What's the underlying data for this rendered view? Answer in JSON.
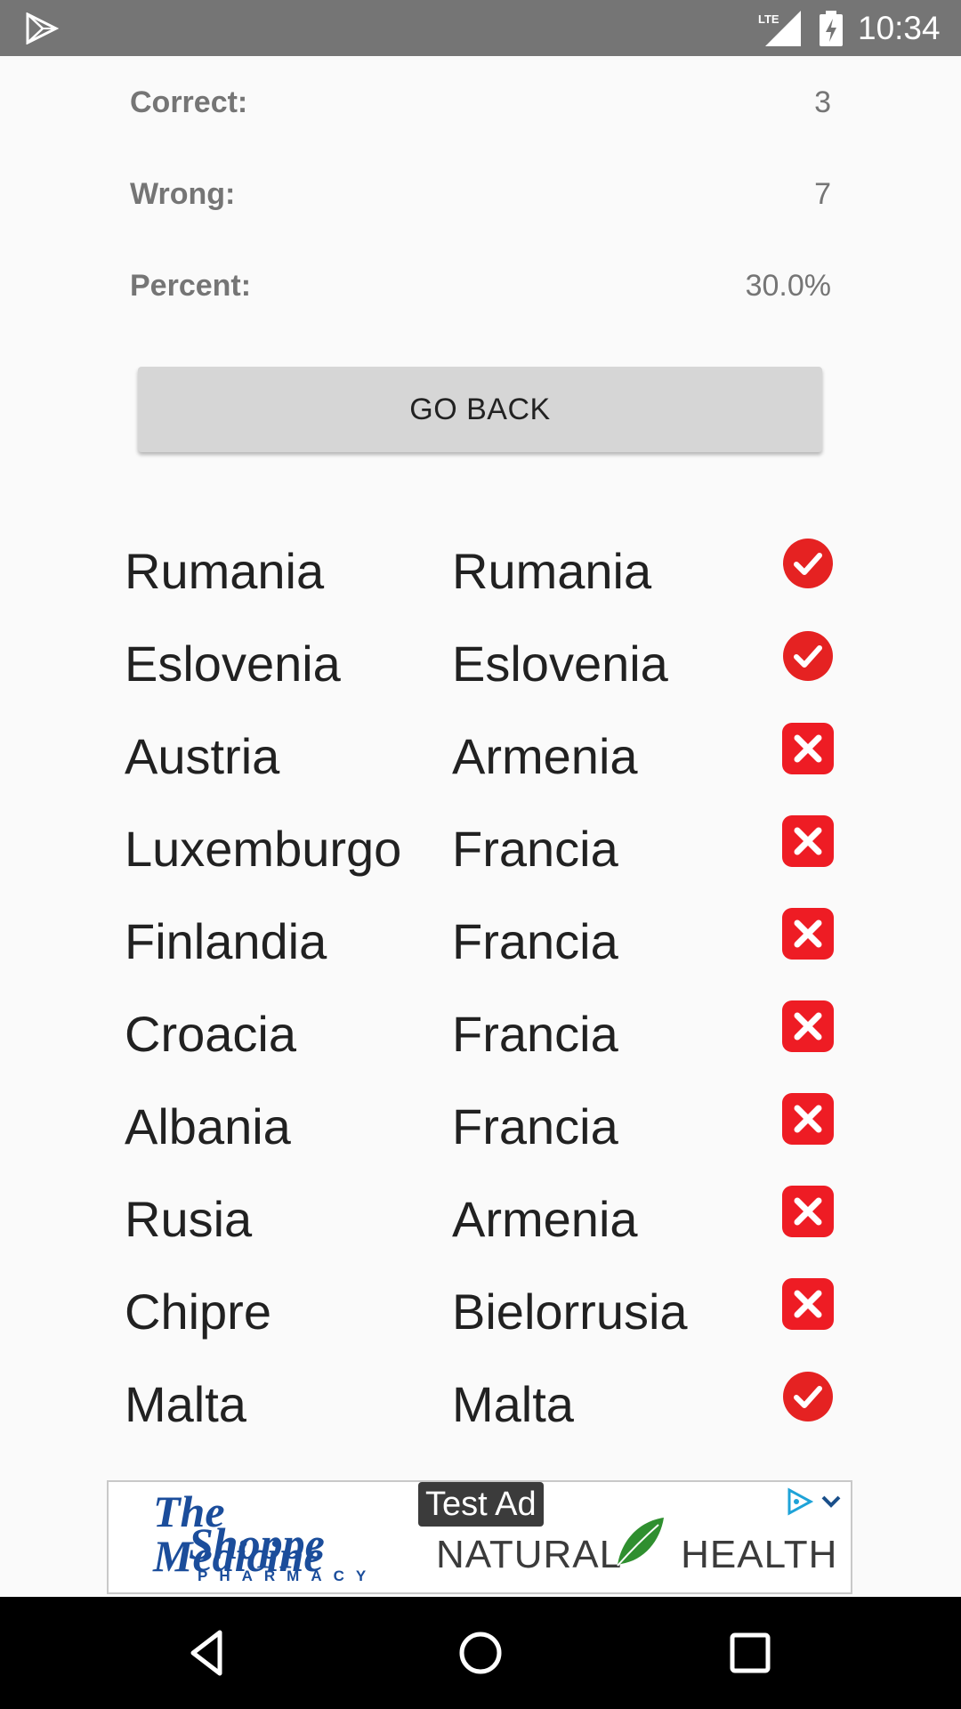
{
  "status_bar": {
    "time": "10:34",
    "network_label": "LTE",
    "icons": [
      "play-store-icon",
      "lte-signal-icon",
      "battery-charging-icon"
    ]
  },
  "stats": {
    "correct_label": "Correct:",
    "correct_value": "3",
    "wrong_label": "Wrong:",
    "wrong_value": "7",
    "percent_label": "Percent:",
    "percent_value": "30.0%"
  },
  "go_back_label": "GO BACK",
  "results": [
    {
      "question": "Rumania",
      "answer": "Rumania",
      "correct": true
    },
    {
      "question": "Eslovenia",
      "answer": "Eslovenia",
      "correct": true
    },
    {
      "question": "Austria",
      "answer": "Armenia",
      "correct": false
    },
    {
      "question": "Luxemburgo",
      "answer": "Francia",
      "correct": false
    },
    {
      "question": "Finlandia",
      "answer": "Francia",
      "correct": false
    },
    {
      "question": "Croacia",
      "answer": "Francia",
      "correct": false
    },
    {
      "question": "Albania",
      "answer": "Francia",
      "correct": false
    },
    {
      "question": "Rusia",
      "answer": "Armenia",
      "correct": false
    },
    {
      "question": "Chipre",
      "answer": "Bielorrusia",
      "correct": false
    },
    {
      "question": "Malta",
      "answer": "Malta",
      "correct": true
    }
  ],
  "ad": {
    "test_label": "Test Ad",
    "logo_line1": "The Medicine",
    "logo_line2": "Shoppe",
    "logo_line3": "PHARMACY",
    "headline_left": "NATURAL",
    "headline_right": "HEALTH"
  },
  "colors": {
    "correct_icon": "#e52222",
    "wrong_icon": "#ee1c24",
    "status_bar": "#757575",
    "button": "#d6d6d6"
  },
  "nav_icons": [
    "back-icon",
    "home-icon",
    "recents-icon"
  ]
}
